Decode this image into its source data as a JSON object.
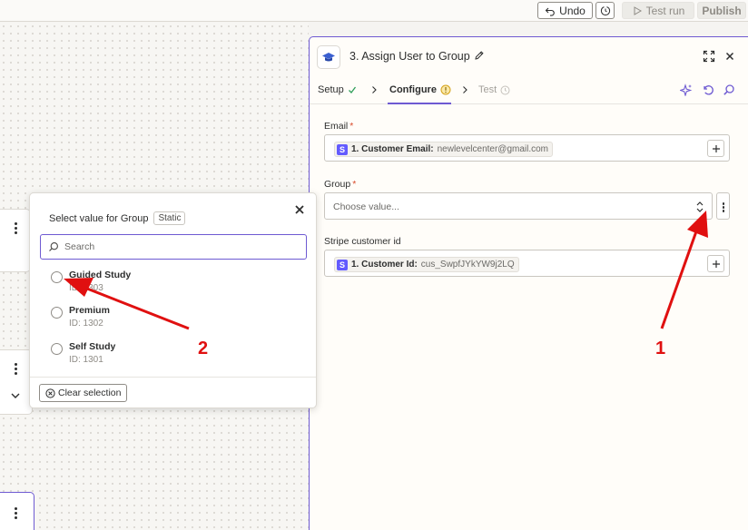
{
  "topbar": {
    "undo_label": "Undo",
    "test_run_label": "Test run",
    "publish_label": "Publish"
  },
  "panel": {
    "title": "3. Assign User to Group",
    "tabs": [
      {
        "label": "Setup",
        "status": "complete"
      },
      {
        "label": "Configure",
        "status": "warning"
      },
      {
        "label": "Test",
        "status": "disabled"
      }
    ],
    "fields": {
      "email": {
        "label": "Email",
        "required_mark": "*",
        "chip_badge": "S",
        "chip_label": "1. Customer Email:",
        "chip_value": "newlevelcenter@gmail.com"
      },
      "group": {
        "label": "Group",
        "required_mark": "*",
        "placeholder": "Choose value..."
      },
      "stripe_customer_id": {
        "label": "Stripe customer id",
        "chip_badge": "S",
        "chip_label": "1. Customer Id:",
        "chip_value": "cus_SwpfJYkYW9j2LQ"
      }
    }
  },
  "popover": {
    "title": "Select value for Group",
    "tag": "Static",
    "search_placeholder": "Search",
    "options": [
      {
        "name": "Guided Study",
        "sub": "ID: 1303"
      },
      {
        "name": "Premium",
        "sub": "ID: 1302"
      },
      {
        "name": "Self Study",
        "sub": "ID: 1301"
      }
    ],
    "clear_label": "Clear selection"
  },
  "annotations": {
    "arrow_1_label": "1",
    "arrow_2_label": "2",
    "color": "#e01010"
  },
  "colors": {
    "accent": "#6e5ad2",
    "stripe": "#635bff",
    "required": "#d94b2b",
    "warning": "#d4a21b",
    "success": "#2f9e5a"
  }
}
